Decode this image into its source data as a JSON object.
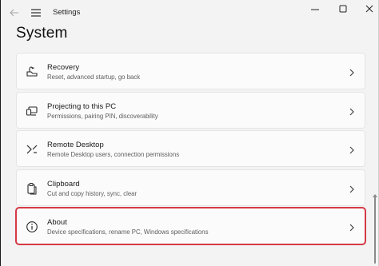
{
  "window": {
    "title": "Settings"
  },
  "page": {
    "title": "System"
  },
  "items": [
    {
      "title": "Recovery",
      "subtitle": "Reset, advanced startup, go back",
      "icon": "recovery-icon"
    },
    {
      "title": "Projecting to this PC",
      "subtitle": "Permissions, pairing PIN, discoverability",
      "icon": "projecting-icon"
    },
    {
      "title": "Remote Desktop",
      "subtitle": "Remote Desktop users, connection permissions",
      "icon": "remote-desktop-icon"
    },
    {
      "title": "Clipboard",
      "subtitle": "Cut and copy history, sync, clear",
      "icon": "clipboard-icon"
    },
    {
      "title": "About",
      "subtitle": "Device specifications, rename PC, Windows specifications",
      "icon": "info-icon",
      "highlighted": true
    }
  ],
  "colors": {
    "highlight": "#d43a45",
    "background": "#f3f3f3",
    "card": "#fbfbfb"
  }
}
